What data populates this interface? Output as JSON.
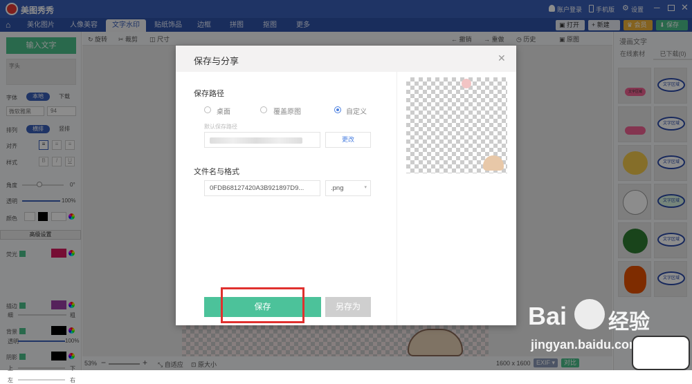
{
  "app": {
    "name": "美图秀秀"
  },
  "titlebar": {
    "account": "账户登录",
    "mobile": "手机版",
    "settings": "设置"
  },
  "tabs": [
    "美化图片",
    "人像美容",
    "文字水印",
    "贴纸饰品",
    "边框",
    "拼图",
    "抠图",
    "更多"
  ],
  "active_tab": 2,
  "top_buttons": {
    "open": "打开",
    "new": "新建",
    "member": "会员",
    "save": "保存"
  },
  "left": {
    "input_text_button": "输入文字",
    "text_box_value": "字头",
    "font_label": "字体",
    "font_local": "本地",
    "font_download": "下载",
    "font_name": "微软雅黑",
    "font_size": "94",
    "arrange_label": "排列",
    "arrange_horizontal": "横排",
    "arrange_vertical": "竖排",
    "align_label": "对齐",
    "style_label": "样式",
    "style_bold": "B",
    "style_italic": "I",
    "style_underline": "U",
    "angle_label": "角度",
    "angle_value": "0°",
    "opacity_label": "透明",
    "opacity_value": "100%",
    "color_label": "颜色",
    "advanced_settings": "高级设置",
    "glow_label": "荧光",
    "stroke_label": "描边",
    "thin_label": "细",
    "thick_label": "粗",
    "bg_label": "背景",
    "bg_opacity_label": "透明",
    "bg_opacity_value": "100%",
    "shadow_label": "阴影",
    "up_label": "上",
    "down_label": "下",
    "left_label": "左",
    "right_label": "右"
  },
  "edit_toolbar": {
    "rotate": "旋转",
    "crop": "裁剪",
    "size": "尺寸",
    "undo": "撤销",
    "redo": "重做",
    "history": "历史",
    "original": "原图"
  },
  "right": {
    "title": "漫画文字",
    "tab_online": "在线素材",
    "tab_downloaded": "已下载(0)",
    "sticker_text": "文字区域"
  },
  "status": {
    "zoom": "53%",
    "fit": "自适应",
    "actual_size": "原大小",
    "dimensions": "1600 x 1600",
    "exif": "EXIF",
    "compare": "对比"
  },
  "dialog": {
    "title": "保存与分享",
    "path_label": "保存路径",
    "option_desktop": "桌面",
    "option_overwrite": "覆盖原图",
    "option_custom": "自定义",
    "default_path_label": "默认保存路径",
    "change_button": "更改",
    "filename_label": "文件名与格式",
    "filename_value": "0FDB68127420A3B921897D9...",
    "format_value": ".png",
    "save_button": "保存",
    "save_as_button": "另存为"
  },
  "watermark": {
    "brand": "Bai",
    "brand2": "经验",
    "url": "jingyan.baidu.com"
  },
  "colors": {
    "accent_green": "#4bbf8a",
    "title_blue": "#3a5fb9",
    "highlight_red": "#e0302e",
    "glow_color": "#d81b60",
    "stroke_color": "#9c3fa6"
  }
}
